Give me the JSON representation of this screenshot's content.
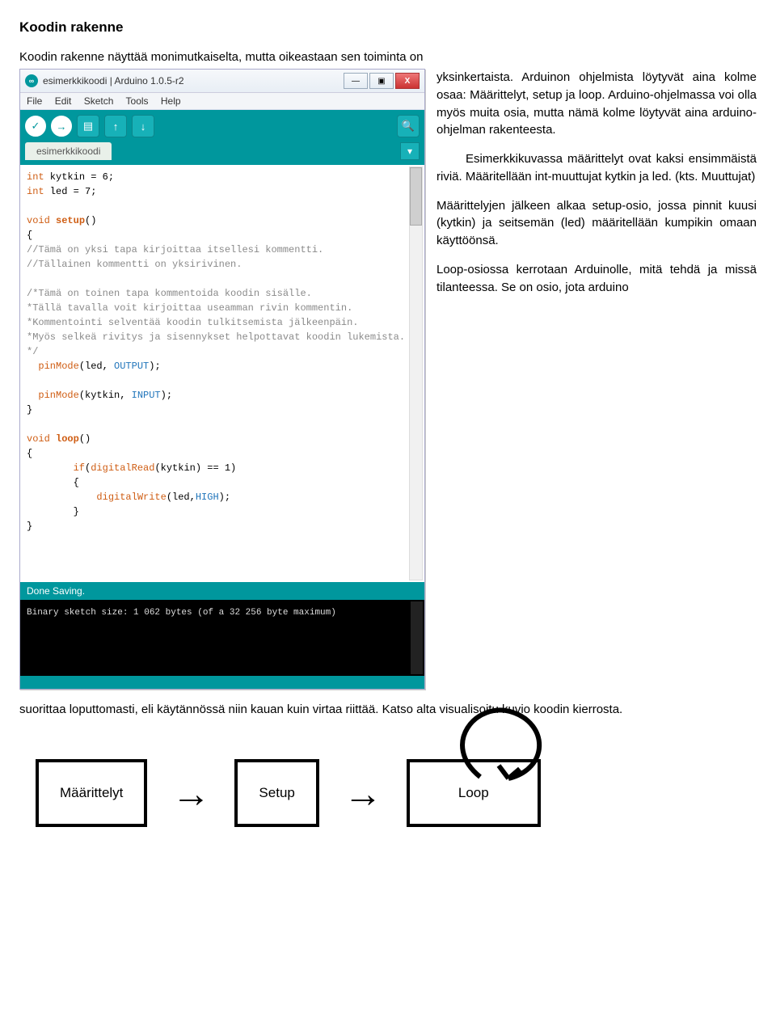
{
  "heading": "Koodin rakenne",
  "intro_top": "Koodin rakenne näyttää monimutkaiselta, mutta oikeastaan sen toiminta on",
  "paragraphs": {
    "p1": "yksinkertaista. Arduinon ohjelmista löytyvät aina kolme osaa: Määrittelyt, setup ja loop. Arduino-ohjelmassa voi olla myös muita osia, mutta nämä kolme löytyvät aina arduino-ohjelman rakenteesta.",
    "p2": "Esimerkkikuvassa määrittelyt ovat kaksi ensimmäistä riviä. Määritellään int-muuttujat kytkin ja led. (kts. Muuttujat)",
    "p3": "Määrittelyjen jälkeen alkaa setup-osio, jossa pinnit kuusi (kytkin) ja seitsemän (led) määritellään kumpikin omaan käyttöönsä.",
    "p4": "Loop-osiossa kerrotaan Arduinolle, mitä tehdä ja missä tilanteessa. Se on osio, jota arduino"
  },
  "after": "suorittaa loputtomasti, eli käytännössä niin kauan kuin virtaa riittää. Katso alta visualisoitu kuvio koodin kierrosta.",
  "ide": {
    "icon": "∞",
    "title": "esimerkkikoodi | Arduino 1.0.5-r2",
    "menu": {
      "file": "File",
      "edit": "Edit",
      "sketch": "Sketch",
      "tools": "Tools",
      "help": "Help"
    },
    "tab": "esimerkkikoodi",
    "winbtns": {
      "min": "—",
      "max": "▣",
      "close": "X"
    },
    "tool_icons": {
      "verify": "✓",
      "upload": "→",
      "new": "▤",
      "open": "↑",
      "save": "↓",
      "serial": "🔍"
    },
    "code": {
      "l1a": "int",
      "l1b": " kytkin = 6;",
      "l2a": "int",
      "l2b": " led = 7;",
      "l3a": "void",
      "l3b": " setup",
      "l3c": "()",
      "l4": "{",
      "l5": "//Tämä on yksi tapa kirjoittaa itsellesi kommentti.",
      "l6": "//Tällainen kommentti on yksirivinen.",
      "l7": "/*Tämä on toinen tapa kommentoida koodin sisälle.",
      "l8": "*Tällä tavalla voit kirjoittaa useamman rivin kommentin.",
      "l9": "*Kommentointi selventää koodin tulkitsemista jälkeenpäin.",
      "l10": "*Myös selkeä rivitys ja sisennykset helpottavat koodin lukemista.",
      "l11": "*/",
      "pm1a": "  pinMode",
      "pm1b": "(led, ",
      "pm1c": "OUTPUT",
      "pm1d": ");",
      "pm2a": "  pinMode",
      "pm2b": "(kytkin, ",
      "pm2c": "INPUT",
      "pm2d": ");",
      "cb": "}",
      "loopA": "void",
      "loopB": " loop",
      "loopC": "()",
      "ob": "{",
      "ifA": "        if",
      "ifB": "(",
      "ifC": "digitalRead",
      "ifD": "(kytkin) == 1)",
      "ob2": "        {",
      "dwA": "            digitalWrite",
      "dwB": "(led,",
      "dwC": "HIGH",
      "dwD": ");",
      "cb2": "        }",
      "cb3": "}"
    },
    "status": "Done Saving.",
    "console": "Binary sketch size: 1 062 bytes (of a 32 256 byte maximum)"
  },
  "diagram": {
    "box1": "Määrittelyt",
    "box2": "Setup",
    "box3": "Loop",
    "arrow": "→"
  }
}
